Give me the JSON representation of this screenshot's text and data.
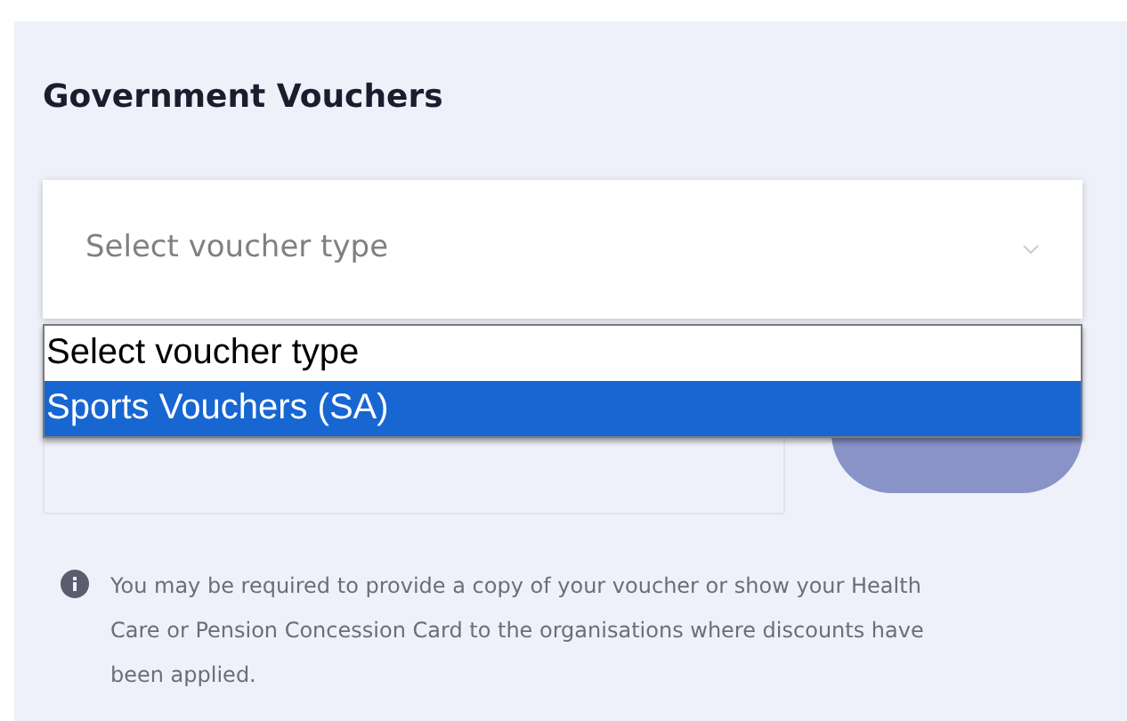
{
  "title": "Government Vouchers",
  "voucher_type_select": {
    "placeholder": "Select voucher type",
    "expanded": true,
    "options": [
      {
        "label": "Select voucher type",
        "selected": false
      },
      {
        "label": "Sports Vouchers (SA)",
        "selected": true
      }
    ]
  },
  "apply_button": {
    "disabled": true
  },
  "info_note": "You may be required to provide a copy of your voucher or show your Health Care or Pension Concession Card to the organisations where discounts have been applied."
}
